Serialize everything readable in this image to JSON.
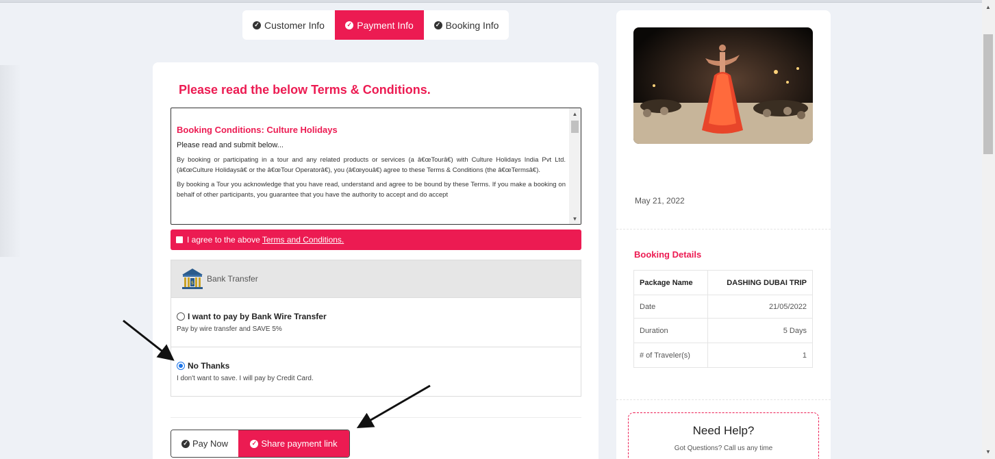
{
  "tabs": [
    {
      "label": "Customer Info",
      "active": false
    },
    {
      "label": "Payment Info",
      "active": true
    },
    {
      "label": "Booking Info",
      "active": false
    }
  ],
  "main": {
    "title": "Please read the below Terms & Conditions.",
    "terms": {
      "heading": "Booking Conditions: Culture Holidays",
      "sub": "Please read and submit below...",
      "para1": "By booking or participating in a tour and any related products or services (a â€œTourâ€) with Culture Holidays India Pvt Ltd. (â€œCulture Holidaysâ€ or the â€œTour Operatorâ€), you (â€œyouâ€) agree to these Terms & Conditions (the â€œTermsâ€).",
      "para2": "By booking a Tour you acknowledge that you have read, understand and agree to be bound by these Terms. If you make a booking on behalf of other participants, you guarantee that you have the authority to accept and do accept"
    },
    "agree": {
      "text": "I agree to the above ",
      "link": "Terms and Conditions."
    },
    "payment": {
      "method_label": "Bank Transfer",
      "options": [
        {
          "title": "I want to pay by Bank Wire Transfer",
          "desc": "Pay by wire transfer and SAVE 5%",
          "selected": false
        },
        {
          "title": "No Thanks",
          "desc": "I don't want to save. I will pay by Credit Card.",
          "selected": true
        }
      ]
    },
    "buttons": {
      "pay_now": "Pay Now",
      "share_link": "Share payment link"
    }
  },
  "sidebar": {
    "date": "May 21, 2022",
    "booking_title": "Booking Details",
    "booking_rows": [
      {
        "label": "Package Name",
        "value": "DASHING DUBAI TRIP"
      },
      {
        "label": "Date",
        "value": "21/05/2022"
      },
      {
        "label": "Duration",
        "value": "5 Days"
      },
      {
        "label": "# of Traveler(s)",
        "value": "1"
      }
    ],
    "help_title": "Need Help?",
    "help_sub": "Got Questions? Call us any time"
  },
  "colors": {
    "accent": "#ec1b52",
    "background": "#eef1f6",
    "radio_selected": "#1a73e8"
  },
  "icons": [
    "check-circle-icon",
    "bank-icon",
    "scroll-up-icon",
    "scroll-down-icon"
  ]
}
